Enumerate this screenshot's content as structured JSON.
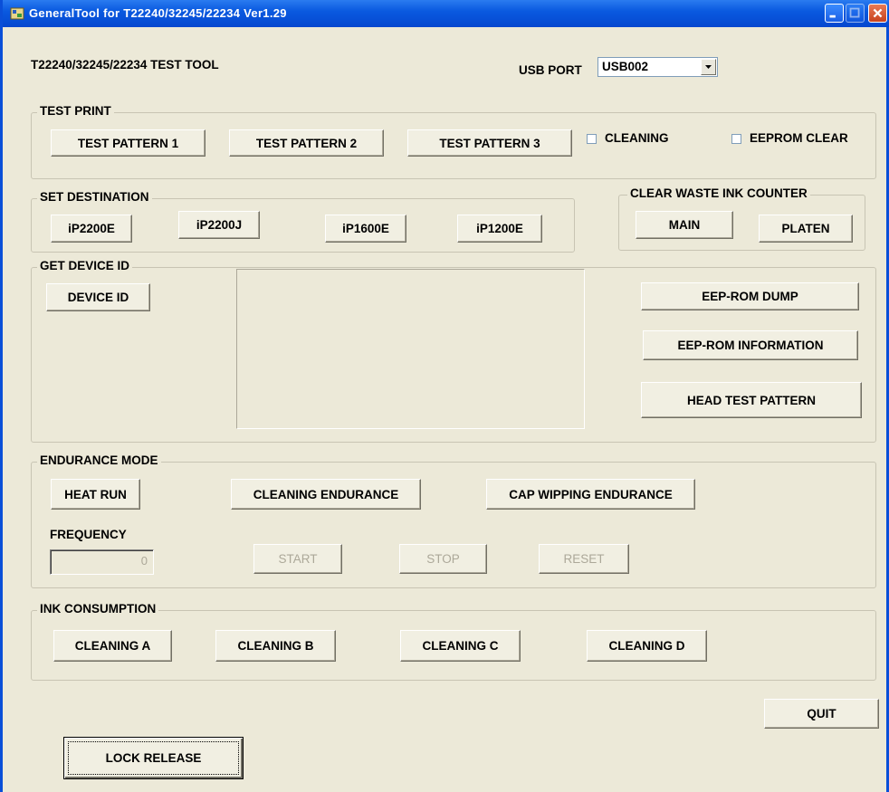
{
  "window": {
    "title": "GeneralTool for T22240/32245/22234 Ver1.29"
  },
  "header": {
    "tool_name": "T22240/32245/22234 TEST TOOL",
    "usb_port_label": "USB PORT",
    "usb_port_value": "USB002"
  },
  "test_print": {
    "legend": "TEST PRINT",
    "buttons": [
      "TEST PATTERN 1",
      "TEST PATTERN 2",
      "TEST PATTERN 3"
    ],
    "cleaning_label": "CLEANING",
    "eeprom_clear_label": "EEPROM CLEAR"
  },
  "set_destination": {
    "legend": "SET DESTINATION",
    "buttons": [
      "iP2200E",
      "iP2200J",
      "iP1600E",
      "iP1200E"
    ]
  },
  "clear_waste": {
    "legend": "CLEAR WASTE INK COUNTER",
    "buttons": [
      "MAIN",
      "PLATEN"
    ]
  },
  "device_id": {
    "legend": "GET DEVICE ID",
    "device_id_button": "DEVICE ID",
    "eeprom_dump": "EEP-ROM DUMP",
    "eeprom_info": "EEP-ROM INFORMATION",
    "head_test": "HEAD TEST PATTERN"
  },
  "endurance": {
    "legend": "ENDURANCE MODE",
    "buttons": [
      "HEAT RUN",
      "CLEANING ENDURANCE",
      "CAP WIPPING ENDURANCE"
    ],
    "frequency_label": "FREQUENCY",
    "frequency_value": "0",
    "start": "START",
    "stop": "STOP",
    "reset": "RESET"
  },
  "ink": {
    "legend": "INK CONSUMPTION",
    "buttons": [
      "CLEANING A",
      "CLEANING B",
      "CLEANING C",
      "CLEANING D"
    ]
  },
  "footer": {
    "quit": "QUIT",
    "lock_release": "LOCK RELEASE"
  }
}
